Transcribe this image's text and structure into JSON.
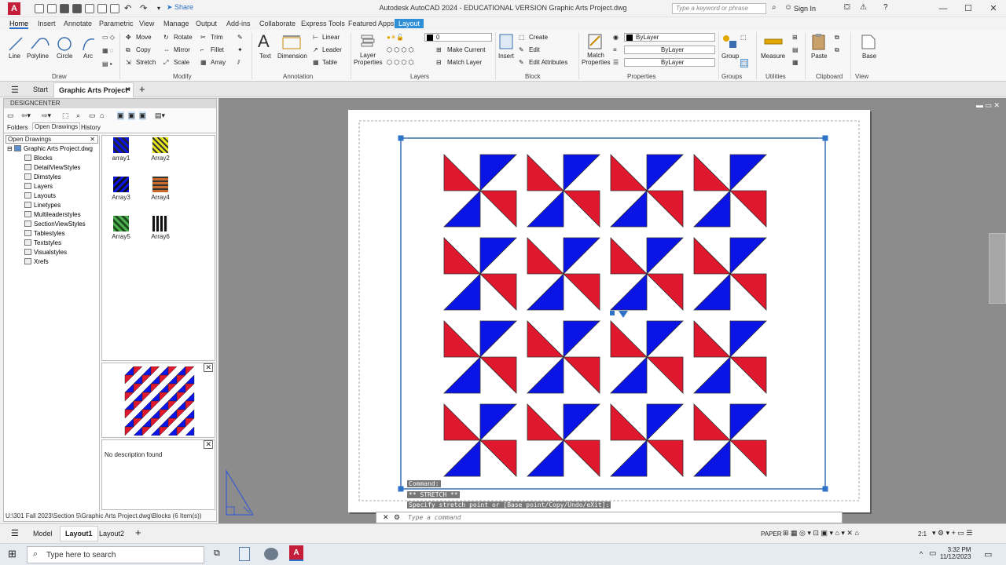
{
  "app": {
    "logo": "A",
    "share_label": "Share",
    "window_title": "Autodesk AutoCAD 2024 - EDUCATIONAL VERSION    Graphic Arts Project.dwg",
    "search_placeholder": "Type a keyword or phrase",
    "sign_in": "Sign In"
  },
  "menu_tabs": [
    "Home",
    "Insert",
    "Annotate",
    "Parametric",
    "View",
    "Manage",
    "Output",
    "Add-ins",
    "Collaborate",
    "Express Tools",
    "Featured Apps",
    "Layout"
  ],
  "ribbon": {
    "draw": {
      "line": "Line",
      "polyline": "Polyline",
      "circle": "Circle",
      "arc": "Arc",
      "title": "Draw"
    },
    "modify": {
      "move": "Move",
      "rotate": "Rotate",
      "trim": "Trim",
      "copy": "Copy",
      "mirror": "Mirror",
      "fillet": "Fillet",
      "stretch": "Stretch",
      "scale": "Scale",
      "array": "Array",
      "title": "Modify"
    },
    "annotation": {
      "text": "Text",
      "dimension": "Dimension",
      "linear": "Linear",
      "leader": "Leader",
      "table": "Table",
      "title": "Annotation"
    },
    "layers": {
      "properties": "Layer Properties",
      "current_layer": "0",
      "make_current": "Make Current",
      "match_layer": "Match Layer",
      "title": "Layers"
    },
    "block": {
      "insert": "Insert",
      "create": "Create",
      "edit": "Edit",
      "edit_attributes": "Edit Attributes",
      "title": "Block"
    },
    "properties": {
      "match": "Match Properties",
      "color": "ByLayer",
      "linetype": "ByLayer",
      "lineweight": "ByLayer",
      "title": "Properties"
    },
    "groups": {
      "group": "Group",
      "title": "Groups"
    },
    "utilities": {
      "measure": "Measure",
      "title": "Utilities"
    },
    "clipboard": {
      "paste": "Paste",
      "title": "Clipboard"
    },
    "view": {
      "base": "Base",
      "title": "View"
    }
  },
  "doc_tabs": {
    "start": "Start",
    "active": "Graphic Arts Project*"
  },
  "designcenter": {
    "title": "DESIGNCENTER",
    "tabs": [
      "Folders",
      "Open Drawings",
      "History"
    ],
    "tree_header": "Open Drawings",
    "tree_root": "Graphic Arts Project.dwg",
    "tree_items": [
      "Blocks",
      "DetailViewStyles",
      "Dimstyles",
      "Layers",
      "Layouts",
      "Linetypes",
      "Multileaderstyles",
      "SectionViewStyles",
      "Tablestyles",
      "Textstyles",
      "Visualstyles",
      "Xrefs"
    ],
    "blocks": [
      "array1",
      "Array2",
      "Array3",
      "Array4",
      "Array5",
      "Array6"
    ],
    "description": "No description found",
    "status_path": "U:\\301 Fall 2023\\Section 5\\Graphic Arts Project.dwg\\Blocks (6 Item(s))"
  },
  "drawing": {
    "rows": 4,
    "cols": 4,
    "color_a": "#e0182d",
    "color_b": "#0a14e6"
  },
  "command": {
    "history": [
      "Command:",
      "** STRETCH **",
      "Specify stretch point or [Base point/Copy/Undo/eXit]:"
    ],
    "placeholder": "Type a command"
  },
  "status": {
    "layout_tabs": [
      "Model",
      "Layout1",
      "Layout2"
    ],
    "paper": "PAPER",
    "scale": "2:1"
  },
  "taskbar": {
    "search": "Type here to search",
    "time": "3:32 PM",
    "date": "11/12/2023"
  }
}
